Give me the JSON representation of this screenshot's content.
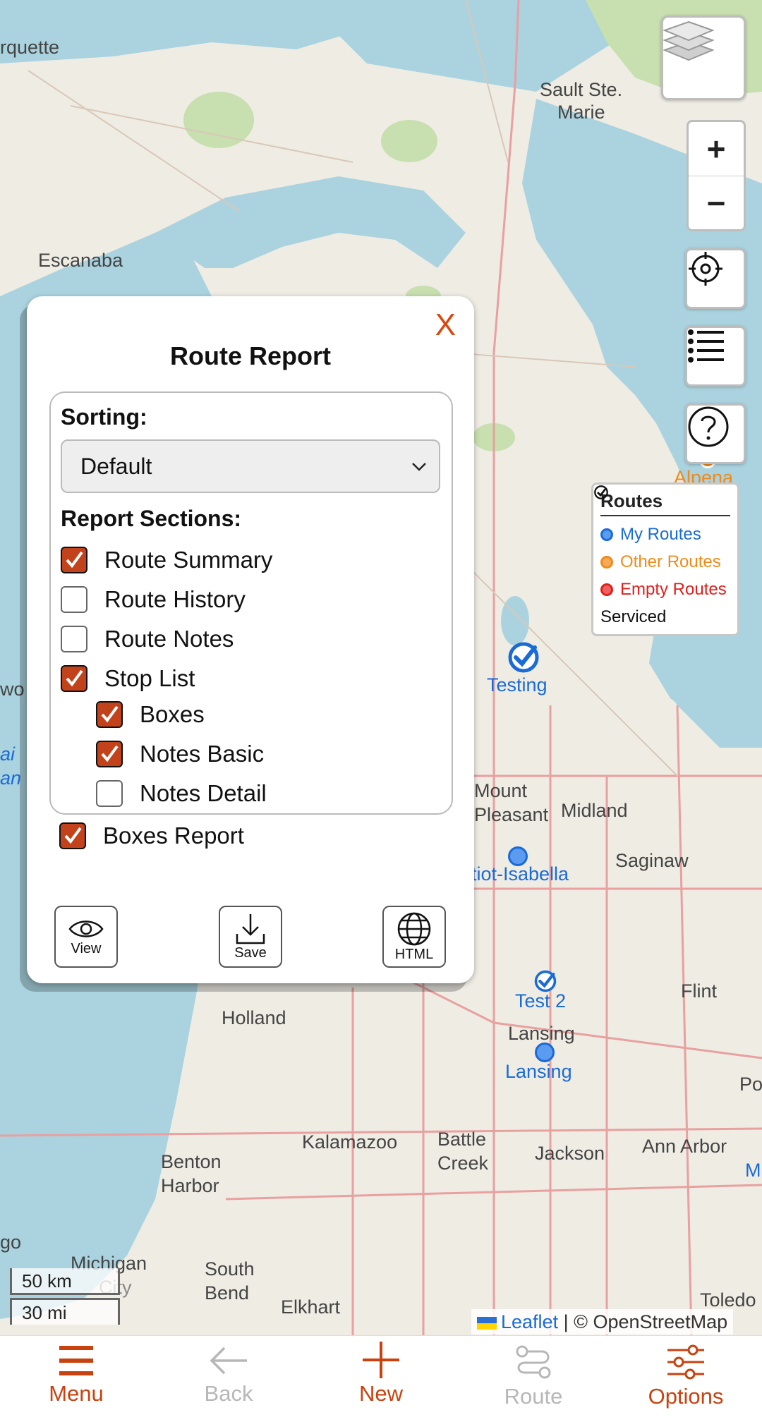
{
  "map": {
    "places": [
      "rquette",
      "Sault Ste.",
      "Marie",
      "Escanaba",
      "Alpena",
      "Mount",
      "Pleasant",
      "Midland",
      "Saginaw",
      "Flint",
      "Holland",
      "Lansing",
      "Kalamazoo",
      "Battle",
      "Creek",
      "Jackson",
      "Ann Arbor",
      "Benton",
      "Harbor",
      "South",
      "Bend",
      "Elkhart",
      "Michigan",
      "City",
      "Toledo",
      "go",
      "wo",
      "ai",
      "an",
      "Po",
      "M"
    ],
    "markers": [
      {
        "label": "Testing",
        "kind": "serviced"
      },
      {
        "label": "tiot-Isabella",
        "kind": "my"
      },
      {
        "label": "Test 2",
        "kind": "serviced"
      },
      {
        "label": "Lansing",
        "kind": "my"
      }
    ],
    "scale_km": "50 km",
    "scale_mi": "30 mi",
    "attribution_leaflet": "Leaflet",
    "attribution_rest": " | © OpenStreetMap"
  },
  "legend": {
    "title": "Routes",
    "items": [
      {
        "label": "My Routes",
        "color": "#1a6bd6"
      },
      {
        "label": "Other Routes",
        "color": "#f08a1a"
      },
      {
        "label": "Empty Routes",
        "color": "#e0201c"
      },
      {
        "label": "Serviced",
        "color": "#111111"
      }
    ]
  },
  "dialog": {
    "close": "X",
    "title": "Route Report",
    "sorting_label": "Sorting:",
    "sorting_value": "Default",
    "sections_label": "Report Sections:",
    "sections": [
      {
        "label": "Route Summary",
        "checked": true
      },
      {
        "label": "Route History",
        "checked": false
      },
      {
        "label": "Route Notes",
        "checked": false
      },
      {
        "label": "Stop List",
        "checked": true
      },
      {
        "label": "Boxes",
        "checked": true
      },
      {
        "label": "Notes Basic",
        "checked": true
      },
      {
        "label": "Notes Detail",
        "checked": false
      },
      {
        "label": "Boxes Report",
        "checked": true
      }
    ],
    "buttons": {
      "view": "View",
      "save": "Save",
      "html": "HTML"
    }
  },
  "nav": {
    "menu": "Menu",
    "back": "Back",
    "new": "New",
    "route": "Route",
    "options": "Options"
  },
  "colors": {
    "accent": "#c8420f",
    "link": "#1a6bd6"
  }
}
